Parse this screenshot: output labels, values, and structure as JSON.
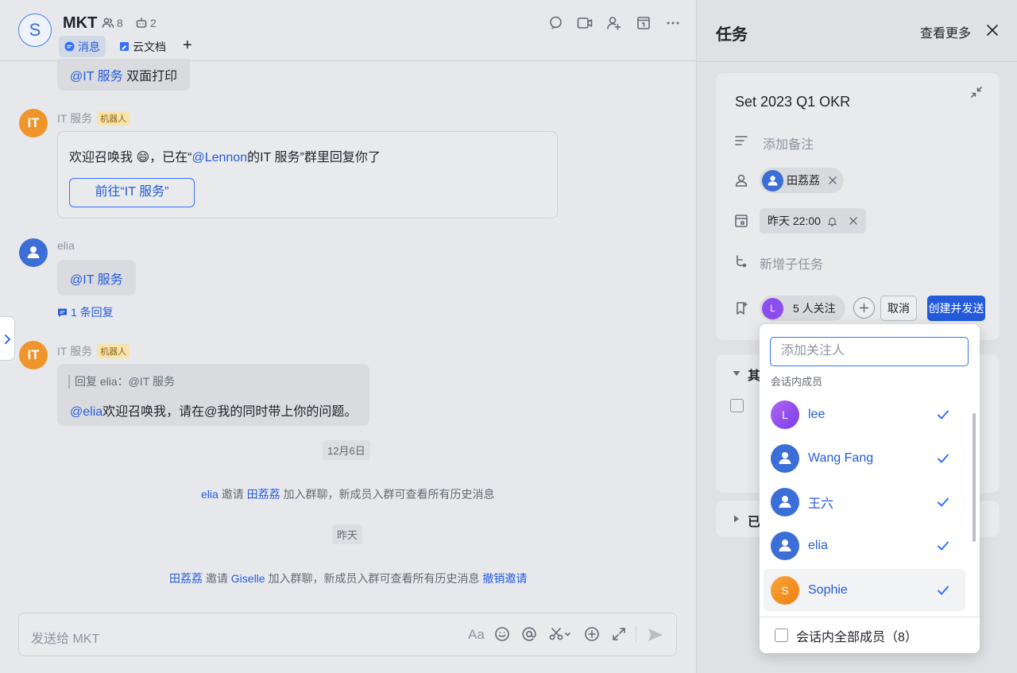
{
  "chat": {
    "avatar_letter": "S",
    "title": "MKT",
    "member_count": "8",
    "bot_count": "2",
    "tabs": [
      {
        "label": "消息"
      },
      {
        "label": "云文档"
      }
    ],
    "add_tab": "+",
    "messages": {
      "top_at": "@IT 服务",
      "top_text": "双面打印",
      "m1_sender": "IT 服务",
      "robot_tag": "机器人",
      "m1_avatar": "IT",
      "m1_text_a": "欢迎召唤我 😄，已在“",
      "m1_mention": "@Lennon",
      "m1_text_b": "的IT 服务”群里回复你了",
      "m1_button": "前往“IT 服务”",
      "m2_sender": "elia",
      "m2_text": "@IT 服务",
      "m2_reply": "1 条回复",
      "m3_sender": "IT 服务",
      "m3_avatar": "IT",
      "m3_quote": "回复 elia：@IT 服务",
      "m3_mention": "@elia",
      "m3_text": "欢迎召唤我，请在@我的同时带上你的问题。",
      "date1": "12月6日",
      "sys1_a": "elia",
      "sys1_b": "邀请",
      "sys1_c": "田荔荔",
      "sys1_d": "加入群聊，新成员入群可查看所有历史消息",
      "date2": "昨天",
      "sys2_a": "田荔荔",
      "sys2_b": "邀请",
      "sys2_c": "Giselle",
      "sys2_d": "加入群聊，新成员入群可查看所有历史消息",
      "sys2_e": "撤销邀请"
    },
    "composer_placeholder": "发送给 MKT"
  },
  "task": {
    "header": "任务",
    "more": "查看更多",
    "title": "Set 2023 Q1 OKR",
    "note_placeholder": "添加备注",
    "assignee": "田荔荔",
    "due": "昨天 22:00",
    "subtask_placeholder": "新增子任务",
    "follower_avatar": "L",
    "followers": "5 人关注",
    "cancel": "取消",
    "create": "创建并发送",
    "section1_partial": "其",
    "section2_partial": "已"
  },
  "dropdown": {
    "placeholder": "添加关注人",
    "group_label": "会话内成员",
    "members": [
      {
        "name": "lee",
        "avatar": "L",
        "checked": true
      },
      {
        "name": "Wang Fang",
        "avatar": "person",
        "checked": true
      },
      {
        "name": "王六",
        "avatar": "person",
        "checked": true
      },
      {
        "name": "elia",
        "avatar": "person",
        "checked": true
      },
      {
        "name": "Sophie",
        "avatar": "S",
        "checked": true
      }
    ],
    "all_members": "会话内全部成员（8）"
  },
  "colors": {
    "accent": "#245bdb",
    "orange": "#f0952c",
    "purple": "#8c4cf0"
  }
}
